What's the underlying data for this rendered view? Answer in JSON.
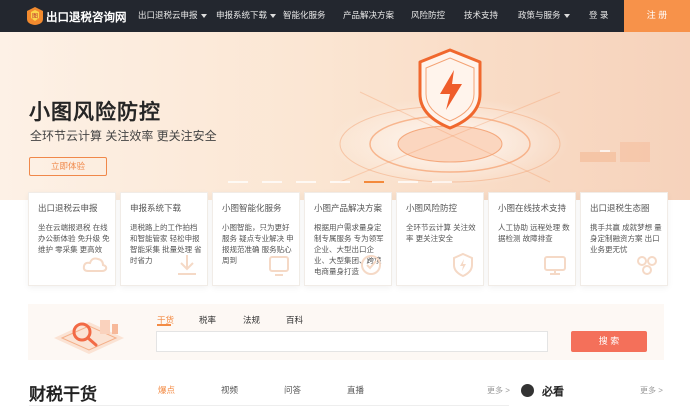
{
  "nav": {
    "logo_text": "出口退税咨询网",
    "items": [
      {
        "label": "出口退税云申报",
        "dropdown": true
      },
      {
        "label": "申报系统下载",
        "dropdown": true
      },
      {
        "label": "智能化服务",
        "dropdown": false
      },
      {
        "label": "产品解决方案",
        "dropdown": false
      },
      {
        "label": "风险防控",
        "dropdown": false
      },
      {
        "label": "技术支持",
        "dropdown": false
      },
      {
        "label": "政策与服务",
        "dropdown": true
      }
    ],
    "login": "登 录",
    "register": "注 册"
  },
  "hero": {
    "title": "小图风险防控",
    "subtitle": "全环节云计算 关注效率 更关注安全",
    "button": "立即体验",
    "slide_count": 7,
    "active_slide": 5
  },
  "cards": [
    {
      "title": "出口退税云申报",
      "desc": "坐在云端报退税 在线办公新体验 免升级 免维护 零采集 更高效",
      "icon": "cloud-icon"
    },
    {
      "title": "申报系统下载",
      "desc": "退税路上的工作拍档和智能管家 轻松申报 智能采集 批量处理 省时省力",
      "icon": "download-icon"
    },
    {
      "title": "小图智能化服务",
      "desc": "小图智能，只为更好服务 疑点专业解决 申报规范准确 服务贴心周到",
      "icon": "smart-service-icon"
    },
    {
      "title": "小图产品解决方案",
      "desc": "根据用户需求量身定制专属服务 专为领军企业、大型出口企业、大型集团、跨境电商量身打造",
      "icon": "solution-icon"
    },
    {
      "title": "小图风险防控",
      "desc": "全环节云计算 关注效率 更关注安全",
      "icon": "shield-icon"
    },
    {
      "title": "小图在线技术支持",
      "desc": "人工协助 远程处理 数据检测 故障排查",
      "icon": "support-icon"
    },
    {
      "title": "出口退税生态圈",
      "desc": "携手共赢 成就梦想 量身定制融资方案 出口业务更无忧",
      "icon": "ecosystem-icon"
    }
  ],
  "search": {
    "tabs": [
      "干货",
      "税率",
      "法规",
      "百科"
    ],
    "active_tab": 0,
    "placeholder": "",
    "button": "搜 索"
  },
  "section": {
    "title": "财税干货",
    "tabs": [
      "爆点",
      "视频",
      "问答",
      "直播"
    ],
    "active_tab": 0,
    "more_left": "更多 >",
    "must_read": "必看",
    "more_right": "更多 >"
  },
  "colors": {
    "nav_bg": "#23272f",
    "accent": "#f7924a",
    "search_button": "#f4705a"
  }
}
